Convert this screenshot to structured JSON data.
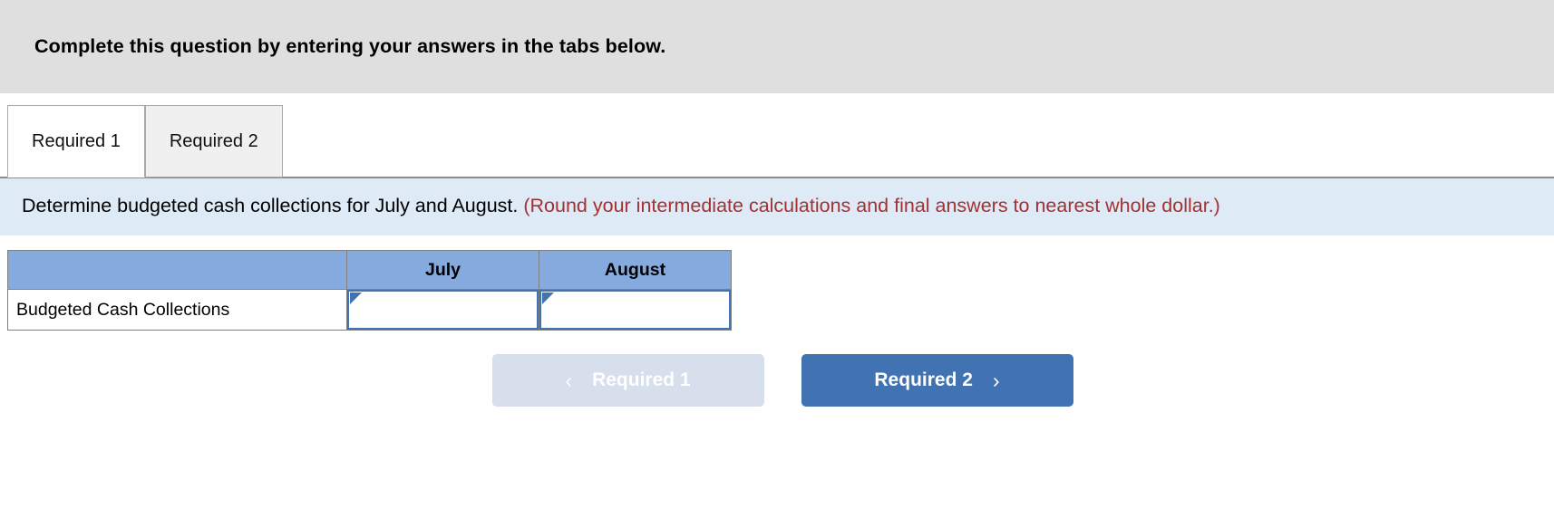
{
  "banner": {
    "title": "Complete this question by entering your answers in the tabs below."
  },
  "tabs": [
    {
      "label": "Required 1",
      "active": true
    },
    {
      "label": "Required 2",
      "active": false
    }
  ],
  "instructions": {
    "main": "Determine budgeted cash collections for July and August.",
    "note": "(Round your intermediate calculations and final answers to nearest whole dollar.)",
    "note_color": "#a33131"
  },
  "table": {
    "headers": [
      "",
      "July",
      "August"
    ],
    "rows": [
      {
        "label": "Budgeted Cash Collections",
        "july": "",
        "august": ""
      }
    ],
    "header_bg": "#84aade",
    "input_border": "#4173b3"
  },
  "nav": {
    "prev_label": "Required 1",
    "next_label": "Required 2",
    "prev_icon": "chevron-left-icon",
    "next_icon": "chevron-right-icon",
    "prev_chevron": "‹",
    "next_chevron": "›",
    "prev_bg": "#d6dfeb",
    "next_bg": "#4173b3"
  }
}
